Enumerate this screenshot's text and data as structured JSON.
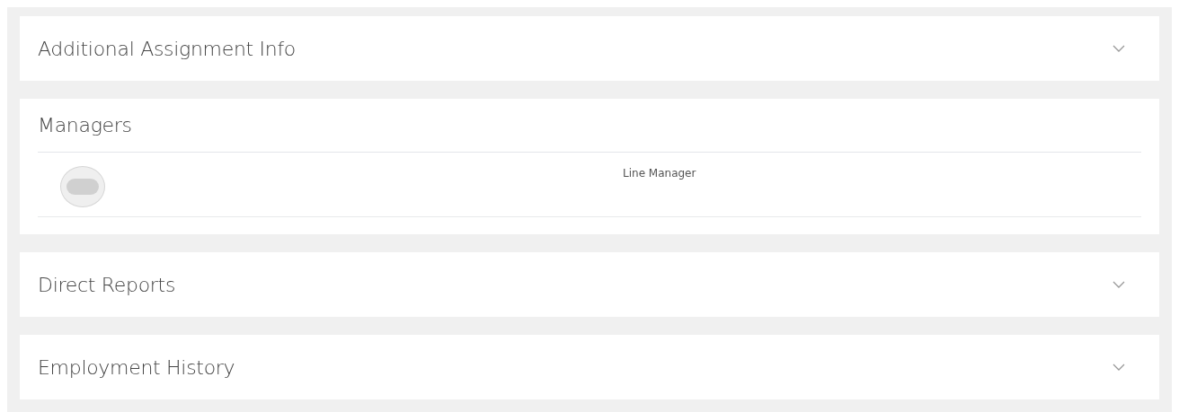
{
  "sections": [
    {
      "title": "Additional Assignment Info",
      "expanded": false
    },
    {
      "title": "Managers",
      "expanded": true,
      "managers": [
        {
          "role": "Line Manager"
        }
      ]
    },
    {
      "title": "Direct Reports",
      "expanded": false
    },
    {
      "title": "Employment History",
      "expanded": false
    }
  ]
}
